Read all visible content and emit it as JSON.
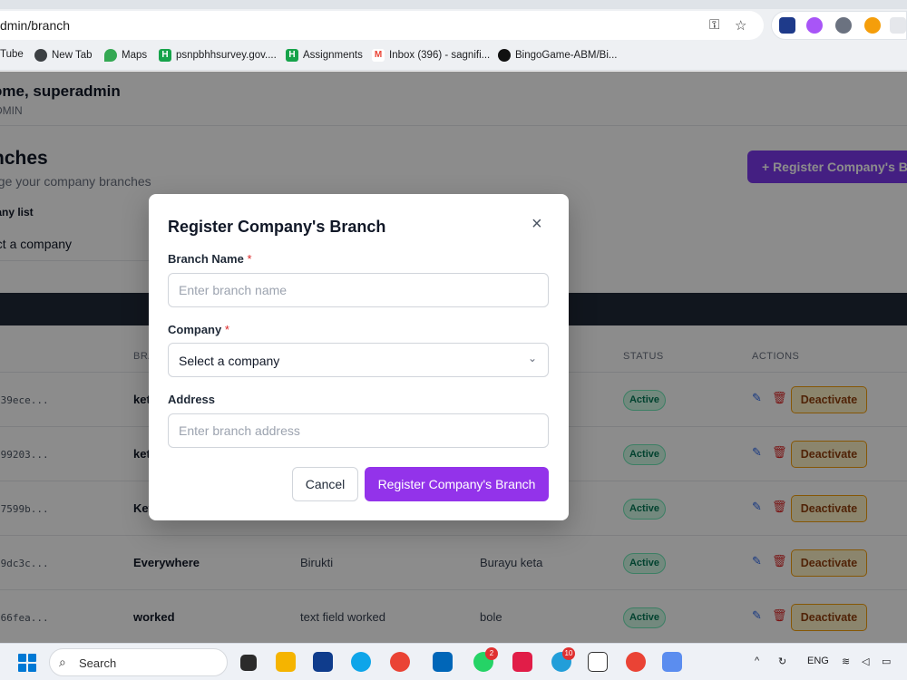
{
  "browser": {
    "url": "dmin/branch",
    "bookmarks": [
      {
        "label": "Tube",
        "icon": "youtube-icon"
      },
      {
        "label": "New Tab",
        "icon": "globe-icon"
      },
      {
        "label": "Maps",
        "icon": "maps-pin-icon"
      },
      {
        "label": "psnpbhhsurvey.gov....",
        "icon": "h-icon"
      },
      {
        "label": "Assignments",
        "icon": "h-icon"
      },
      {
        "label": "Inbox (396) - sagnifi...",
        "icon": "gmail-icon"
      },
      {
        "label": "BingoGame-ABM/Bi...",
        "icon": "github-icon"
      }
    ]
  },
  "header": {
    "welcome": "ome, superadmin",
    "role": "DMIN"
  },
  "page": {
    "title": "nches",
    "subtitle": "age your company branches",
    "register_button": "+  Register Company's B",
    "filter_label": "pany list",
    "filter_value": "ect a company"
  },
  "table": {
    "headers": {
      "name": "BRA",
      "status": "STATUS",
      "actions": "ACTIONS"
    },
    "rows": [
      {
        "id": "039ece...",
        "name": "ket",
        "company": "",
        "address": "",
        "status": "Active",
        "action": "Deactivate"
      },
      {
        "id": "599203...",
        "name": "ket",
        "company": "",
        "address": "",
        "status": "Active",
        "action": "Deactivate"
      },
      {
        "id": "b7599b...",
        "name": "Ket",
        "company": "",
        "address": "",
        "status": "Active",
        "action": "Deactivate"
      },
      {
        "id": "a9dc3c...",
        "name": "Everywhere",
        "company": "Birukti",
        "address": "Burayu keta",
        "status": "Active",
        "action": "Deactivate"
      },
      {
        "id": "066fea...",
        "name": "worked",
        "company": "text field worked",
        "address": "bole",
        "status": "Active",
        "action": "Deactivate"
      }
    ]
  },
  "modal": {
    "title": "Register Company's Branch",
    "close": "×",
    "branch_label": "Branch Name",
    "branch_placeholder": "Enter branch name",
    "company_label": "Company",
    "company_value": "Select a company",
    "address_label": "Address",
    "address_placeholder": "Enter branch address",
    "required_mark": "*",
    "cancel": "Cancel",
    "submit": "Register Company's Branch"
  },
  "taskbar": {
    "search_label": "Search",
    "whatsapp_badge": "2",
    "telegram_badge": "10",
    "language": "ENG"
  }
}
